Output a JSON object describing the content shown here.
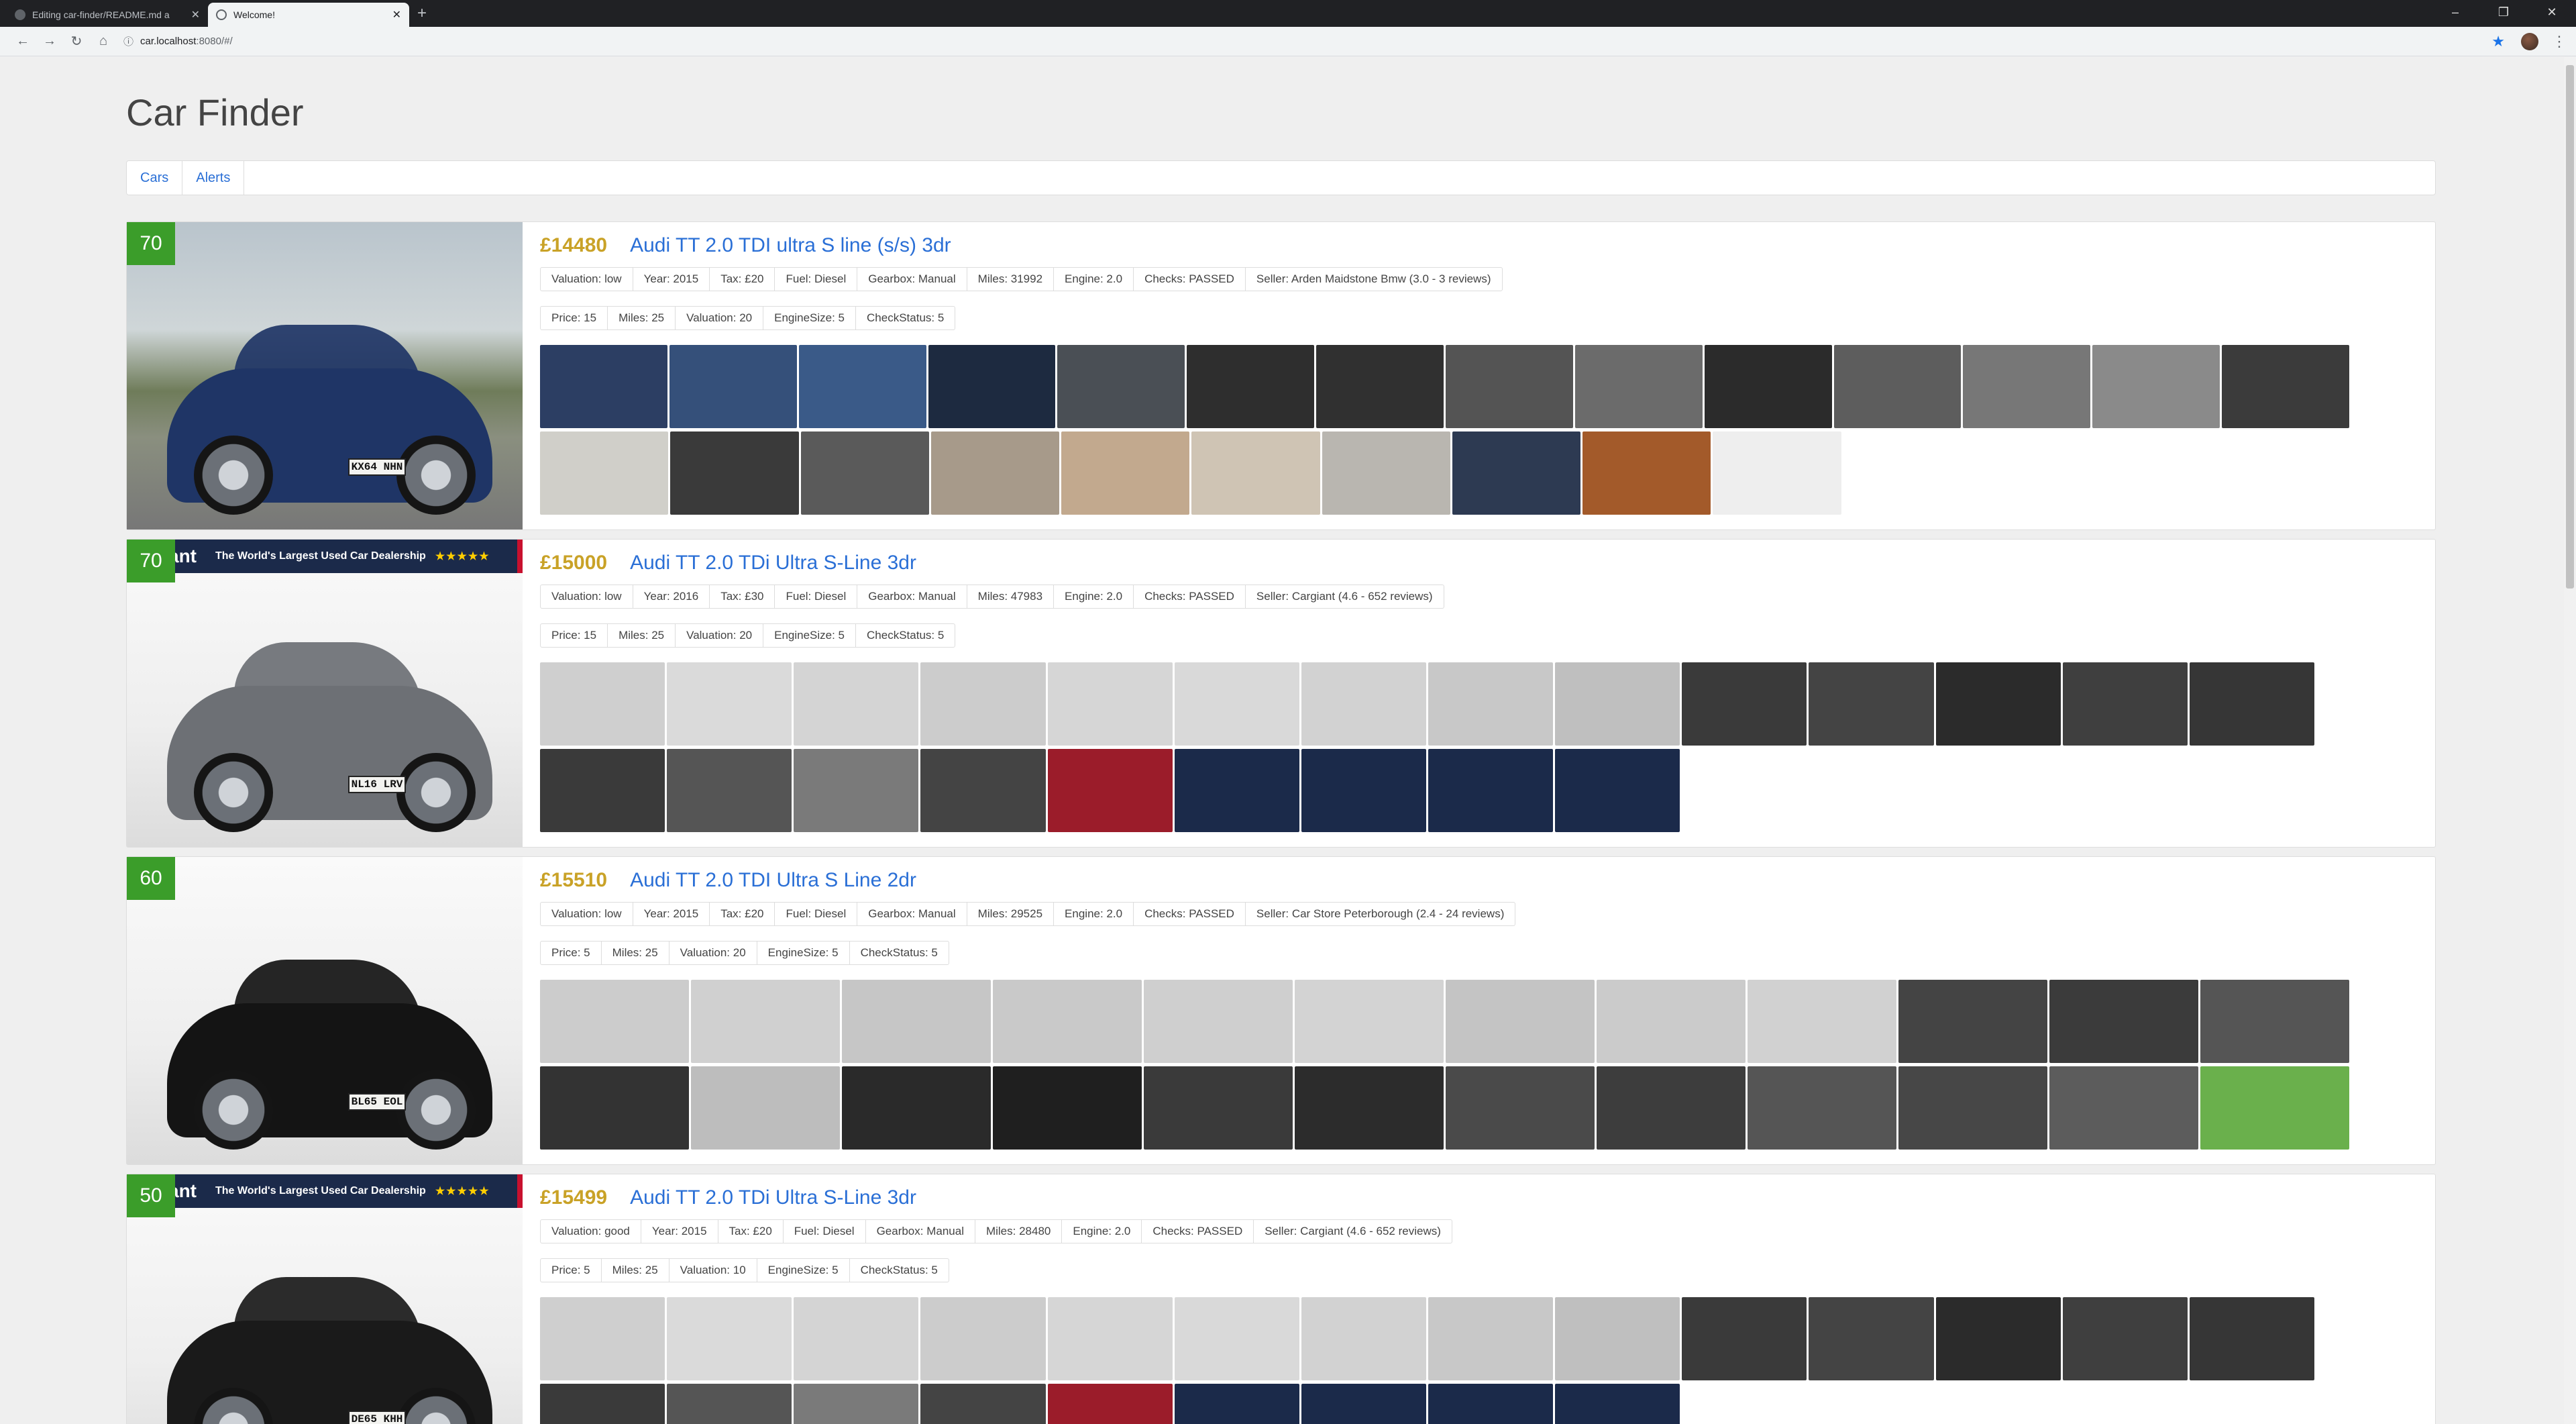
{
  "browser": {
    "tabs": [
      {
        "title": "Editing car-finder/README.md a",
        "active": false
      },
      {
        "title": "Welcome!",
        "active": true
      }
    ],
    "url_host": "car.localhost",
    "url_path": ":8080/#/"
  },
  "app": {
    "title": "Car Finder",
    "nav": [
      "Cars",
      "Alerts"
    ]
  },
  "listings": [
    {
      "score": "70",
      "price": "£14480",
      "title": "Audi TT 2.0 TDI ultra S line (s/s) 3dr",
      "details": [
        "Valuation: low",
        "Year: 2015",
        "Tax: £20",
        "Fuel: Diesel",
        "Gearbox: Manual",
        "Miles: 31992",
        "Engine: 2.0",
        "Checks: PASSED",
        "Seller: Arden Maidstone Bmw (3.0 - 3 reviews)"
      ],
      "scores": [
        "Price: 15",
        "Miles: 25",
        "Valuation: 20",
        "EngineSize: 5",
        "CheckStatus: 5"
      ],
      "plate": "KX64 NHN",
      "banner": null,
      "car_color": "#1f3566",
      "bg_style": "outdoor",
      "thumb_rows": [
        {
          "count": 14,
          "width": 75
        },
        {
          "count": 10,
          "width": 75
        }
      ],
      "thumb_palette": [
        "#2c3e63",
        "#35507a",
        "#3a5a88",
        "#1d2a40",
        "#4a4f55",
        "#2e2e2e",
        "#303030",
        "#545454",
        "#6b6b6b",
        "#2b2b2b",
        "#5d5d5d",
        "#777777",
        "#8a8a8a",
        "#3b3b3b"
      ],
      "thumb_palette2": [
        "#d0cfc9",
        "#3a3a3a",
        "#5a5a5a",
        "#a79a8a",
        "#c2a98e",
        "#cfc4b4",
        "#b9b6b0",
        "#2d3a52",
        "#a35a2a",
        "#eeeeee"
      ]
    },
    {
      "score": "70",
      "price": "£15000",
      "title": "Audi TT 2.0 TDi Ultra S-Line 3dr",
      "details": [
        "Valuation: low",
        "Year: 2016",
        "Tax: £30",
        "Fuel: Diesel",
        "Gearbox: Manual",
        "Miles: 47983",
        "Engine: 2.0",
        "Checks: PASSED",
        "Seller: Cargiant (4.6 - 652 reviews)"
      ],
      "scores": [
        "Price: 15",
        "Miles: 25",
        "Valuation: 20",
        "EngineSize: 5",
        "CheckStatus: 5"
      ],
      "plate": "NL16 LRV",
      "banner": {
        "brand": "ant",
        "text": "The World's Largest Used Car Dealership",
        "stars": "★★★★★"
      },
      "car_color": "#6d7075",
      "bg_style": "studio",
      "thumb_rows": [
        {
          "count": 14,
          "width": 73
        },
        {
          "count": 9,
          "width": 73
        }
      ],
      "thumb_palette": [
        "#cfcfcf",
        "#dadada",
        "#d4d4d4",
        "#cccccc",
        "#d6d6d6",
        "#d9d9d9",
        "#d2d2d2",
        "#c8c8c8",
        "#bfbfbf",
        "#3a3a3a",
        "#444444",
        "#2b2b2b",
        "#3f3f3f",
        "#363636"
      ],
      "thumb_palette2": [
        "#3a3a3a",
        "#555555",
        "#7a7a7a",
        "#444444",
        "#9b1c2a",
        "#1b2a4a",
        "#1b2a4a",
        "#1b2a4a",
        "#1b2a4a"
      ]
    },
    {
      "score": "60",
      "price": "£15510",
      "title": "Audi TT 2.0 TDI Ultra S Line 2dr",
      "details": [
        "Valuation: low",
        "Year: 2015",
        "Tax: £20",
        "Fuel: Diesel",
        "Gearbox: Manual",
        "Miles: 29525",
        "Engine: 2.0",
        "Checks: PASSED",
        "Seller: Car Store Peterborough (2.4 - 24 reviews)"
      ],
      "scores": [
        "Price: 5",
        "Miles: 25",
        "Valuation: 20",
        "EngineSize: 5",
        "CheckStatus: 5"
      ],
      "plate": "BL65 EOL",
      "banner": null,
      "car_color": "#141414",
      "bg_style": "studio",
      "thumb_rows": [
        {
          "count": 12,
          "width": 88
        },
        {
          "count": 12,
          "width": 88
        }
      ],
      "thumb_palette": [
        "#cccccc",
        "#d0d0d0",
        "#c6c6c6",
        "#c9c9c9",
        "#cfcfcf",
        "#d3d3d3",
        "#c4c4c4",
        "#cbcbcb",
        "#d1d1d1",
        "#444444",
        "#3b3b3b",
        "#555555"
      ],
      "thumb_palette2": [
        "#333333",
        "#bdbdbd",
        "#2a2a2a",
        "#1f1f1f",
        "#3a3a3a",
        "#2c2c2c",
        "#4a4a4a",
        "#3d3d3d",
        "#555555",
        "#474747",
        "#5c5c5c",
        "#6ab04c"
      ]
    },
    {
      "score": "50",
      "price": "£15499",
      "title": "Audi TT 2.0 TDi Ultra S-Line 3dr",
      "details": [
        "Valuation: good",
        "Year: 2015",
        "Tax: £20",
        "Fuel: Diesel",
        "Gearbox: Manual",
        "Miles: 28480",
        "Engine: 2.0",
        "Checks: PASSED",
        "Seller: Cargiant (4.6 - 652 reviews)"
      ],
      "scores": [
        "Price: 5",
        "Miles: 25",
        "Valuation: 10",
        "EngineSize: 5",
        "CheckStatus: 5"
      ],
      "plate": "DE65 KHH",
      "banner": {
        "brand": "ant",
        "text": "The World's Largest Used Car Dealership",
        "stars": "★★★★★"
      },
      "car_color": "#1a1a1a",
      "bg_style": "studio",
      "thumb_rows": [
        {
          "count": 14,
          "width": 73
        },
        {
          "count": 9,
          "width": 73
        }
      ],
      "thumb_palette": [
        "#cfcfcf",
        "#dadada",
        "#d4d4d4",
        "#cccccc",
        "#d6d6d6",
        "#d9d9d9",
        "#d2d2d2",
        "#c8c8c8",
        "#bfbfbf",
        "#3a3a3a",
        "#444444",
        "#2b2b2b",
        "#3f3f3f",
        "#363636"
      ],
      "thumb_palette2": [
        "#3a3a3a",
        "#555555",
        "#7a7a7a",
        "#444444",
        "#9b1c2a",
        "#1b2a4a",
        "#1b2a4a",
        "#1b2a4a",
        "#1b2a4a"
      ]
    }
  ],
  "icons": {
    "back": "arrow-left-icon",
    "forward": "arrow-right-icon",
    "reload": "reload-icon",
    "home": "home-icon",
    "info": "info-icon",
    "bookmark": "star-icon",
    "menu": "kebab-menu-icon"
  },
  "colors": {
    "score_badge": "#3b9d2a",
    "price": "#c9a227",
    "link": "#2a6fd6"
  }
}
